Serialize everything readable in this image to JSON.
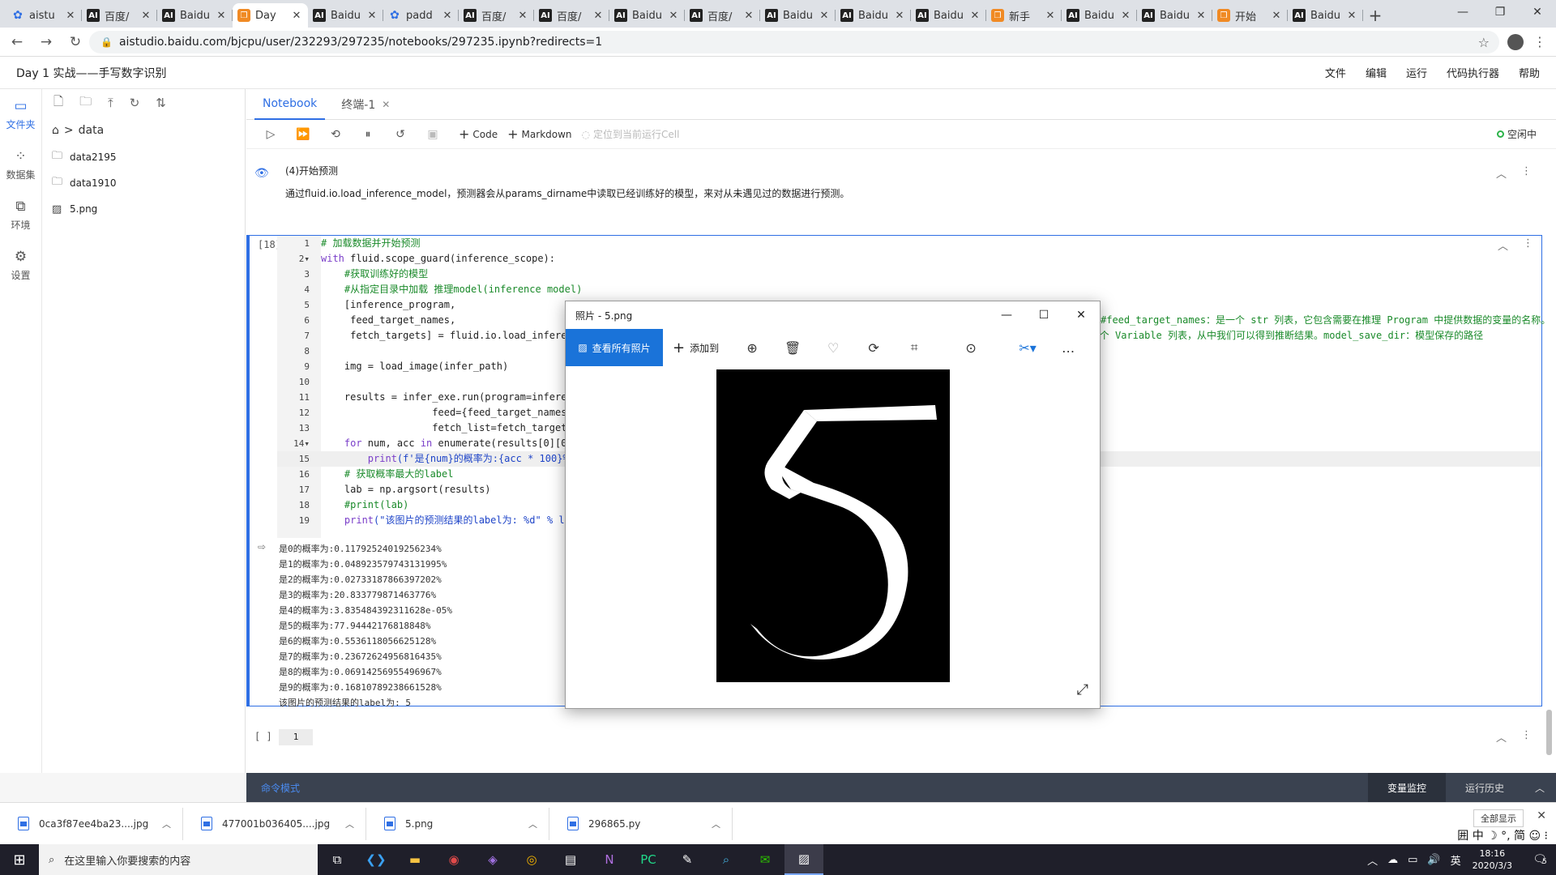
{
  "browser": {
    "tabs": [
      {
        "label": "aistu",
        "fav": "paw",
        "active": false
      },
      {
        "label": "百度/",
        "fav": "ai",
        "active": false
      },
      {
        "label": "Baidu",
        "fav": "ai",
        "active": false
      },
      {
        "label": "Day",
        "fav": "book",
        "active": true
      },
      {
        "label": "Baidu",
        "fav": "ai",
        "active": false
      },
      {
        "label": "padd",
        "fav": "paw",
        "active": false
      },
      {
        "label": "百度/",
        "fav": "ai",
        "active": false
      },
      {
        "label": "百度/",
        "fav": "ai",
        "active": false
      },
      {
        "label": "Baidu",
        "fav": "ai",
        "active": false
      },
      {
        "label": "百度/",
        "fav": "ai",
        "active": false
      },
      {
        "label": "Baidu",
        "fav": "ai",
        "active": false
      },
      {
        "label": "Baidu",
        "fav": "ai",
        "active": false
      },
      {
        "label": "Baidu",
        "fav": "ai",
        "active": false
      },
      {
        "label": "新手",
        "fav": "book",
        "active": false
      },
      {
        "label": "Baidu",
        "fav": "ai",
        "active": false
      },
      {
        "label": "Baidu",
        "fav": "ai",
        "active": false
      },
      {
        "label": "开始",
        "fav": "book",
        "active": false
      },
      {
        "label": "Baidu",
        "fav": "ai",
        "active": false
      }
    ],
    "url": "aistudio.baidu.com/bjcpu/user/232293/297235/notebooks/297235.ipynb?redirects=1"
  },
  "app": {
    "title": "Day 1 实战——手写数字识别",
    "menus": [
      "文件",
      "编辑",
      "运行",
      "代码执行器",
      "帮助"
    ]
  },
  "rail": [
    {
      "label": "文件夹",
      "icon": "folder-icon",
      "glyph": "▭",
      "active": true
    },
    {
      "label": "数据集",
      "icon": "dataset-icon",
      "glyph": "⁘",
      "active": false
    },
    {
      "label": "环境",
      "icon": "env-icon",
      "glyph": "⧉",
      "active": false
    },
    {
      "label": "设置",
      "icon": "settings-icon",
      "glyph": "⚙",
      "active": false
    }
  ],
  "files": {
    "crumb": "data",
    "items": [
      {
        "name": "data2195",
        "type": "folder"
      },
      {
        "name": "data1910",
        "type": "folder"
      },
      {
        "name": "5.png",
        "type": "image"
      }
    ]
  },
  "notebook": {
    "tabs": [
      {
        "label": "Notebook",
        "active": true
      },
      {
        "label": "终端-1",
        "active": false
      }
    ],
    "toolbar": {
      "code_label": "Code",
      "markdown_label": "Markdown",
      "locate_label": "定位到当前运行Cell",
      "kernel_status": "空闲中"
    },
    "md_cell": {
      "heading": "(4)开始预测",
      "text": "通过fluid.io.load_inference_model，预测器会从params_dirname中读取已经训练好的模型，来对从未遇见过的数据进行预测。"
    },
    "code_cell": {
      "prompt": "[18]",
      "lines": [
        {
          "n": "1",
          "parts": [
            {
              "c": "cm",
              "t": "# 加载数据并开始预测"
            }
          ]
        },
        {
          "n": "2▾",
          "parts": [
            {
              "c": "kw",
              "t": "with"
            },
            {
              "c": "",
              "t": " fluid.scope_guard(inference_scope):"
            }
          ]
        },
        {
          "n": "3",
          "parts": [
            {
              "c": "cm",
              "t": "    #获取训练好的模型"
            }
          ]
        },
        {
          "n": "4",
          "parts": [
            {
              "c": "cm",
              "t": "    #从指定目录中加载 推理model(inference model)"
            }
          ]
        },
        {
          "n": "5",
          "parts": [
            {
              "c": "",
              "t": "    [inference_program,"
            }
          ]
        },
        {
          "n": "6",
          "parts": [
            {
              "c": "",
              "t": "     feed_target_names,"
            }
          ]
        },
        {
          "n": "7",
          "parts": [
            {
              "c": "",
              "t": "     fetch_targets] = fluid.io.load_inference_model(model_save_dir,"
            },
            {
              "c": "cm",
              "t": "                                               #fetch_targets：是一个 Variable 列表，从中我们可以得到推断结果。model_save_dir：模型保存的路径"
            }
          ]
        },
        {
          "n": "8",
          "parts": [
            {
              "c": "",
              "t": ""
            }
          ]
        },
        {
          "n": "9",
          "parts": [
            {
              "c": "",
              "t": "    img = load_image(infer_path)"
            }
          ]
        },
        {
          "n": "10",
          "parts": [
            {
              "c": "",
              "t": ""
            }
          ]
        },
        {
          "n": "11",
          "parts": [
            {
              "c": "",
              "t": "    results = infer_exe.run(program=inference_program,"
            }
          ]
        },
        {
          "n": "12",
          "parts": [
            {
              "c": "",
              "t": "                   feed={feed_target_names[0]: img},"
            }
          ]
        },
        {
          "n": "13",
          "parts": [
            {
              "c": "",
              "t": "                   fetch_list=fetch_targets)"
            }
          ]
        },
        {
          "n": "14▾",
          "parts": [
            {
              "c": "kw",
              "t": "    for"
            },
            {
              "c": "",
              "t": " num, acc "
            },
            {
              "c": "kw",
              "t": "in"
            },
            {
              "c": "",
              "t": " enumerate(results[0][0]):"
            }
          ]
        },
        {
          "n": "15",
          "parts": [
            {
              "c": "kw",
              "t": "        print"
            },
            {
              "c": "st",
              "t": "(f'是{num}的概率为:{acc * 100}%')"
            }
          ],
          "cur": true
        },
        {
          "n": "16",
          "parts": [
            {
              "c": "cm",
              "t": "    # 获取概率最大的label"
            }
          ]
        },
        {
          "n": "17",
          "parts": [
            {
              "c": "",
              "t": "    lab = np.argsort(results)"
            }
          ]
        },
        {
          "n": "18",
          "parts": [
            {
              "c": "cm",
              "t": "    #print(lab)"
            }
          ]
        },
        {
          "n": "19",
          "parts": [
            {
              "c": "kw",
              "t": "    print"
            },
            {
              "c": "st",
              "t": "(\"该图片的预测结果的label为: %d\" % lab[0][0][-1])"
            }
          ]
        }
      ],
      "extra_comment_1": "#feed_target_names：是一个 str 列表，它包含需要在推理 Program 中提供数据的变量的名称。",
      "output": [
        "是0的概率为:0.11792524019256234%",
        "是1的概率为:0.048923579743131995%",
        "是2的概率为:0.02733187866397202%",
        "是3的概率为:20.833779871463776%",
        "是4的概率为:3.835484392311628e-05%",
        "是5的概率为:77.94442176818848%",
        "是6的概率为:0.5536118056625128%",
        "是7的概率为:0.23672624956816435%",
        "是8的概率为:0.06914256955496967%",
        "是9的概率为:0.16810789238661528%",
        "该图片的预测结果的label为: 5"
      ]
    },
    "empty_cell": {
      "prompt": "[ ]",
      "line": "1"
    },
    "status": {
      "mode": "命令模式",
      "var_monitor": "变量监控",
      "run_history": "运行历史"
    }
  },
  "photos": {
    "title": "照片 - 5.png",
    "view_all": "查看所有照片",
    "add_to": "添加到"
  },
  "downloads": {
    "items": [
      {
        "name": "0ca3f87ee4ba23....jpg"
      },
      {
        "name": "477001b036405....jpg"
      },
      {
        "name": "5.png"
      },
      {
        "name": "296865.py"
      }
    ],
    "show_all": "全部显示",
    "ime": "囲 中 ☽ °, 简 ☺ ⁝"
  },
  "taskbar": {
    "search_placeholder": "在这里输入你要搜索的内容",
    "time": "18:16",
    "date": "2020/3/3",
    "notif_count": "5"
  }
}
